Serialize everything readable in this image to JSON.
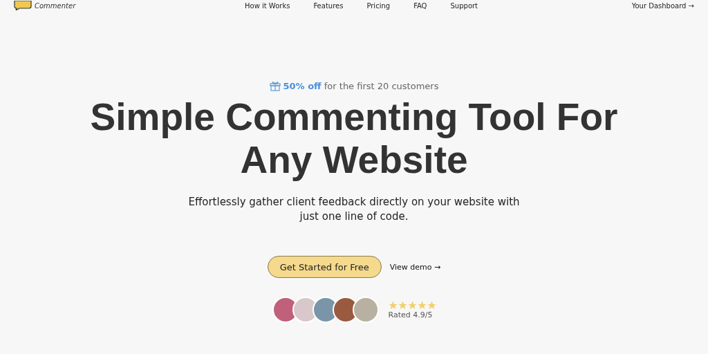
{
  "nav": {
    "logo_text": "Commenter",
    "links": [
      {
        "label": "How it Works"
      },
      {
        "label": "Features"
      },
      {
        "label": "Pricing"
      },
      {
        "label": "FAQ"
      },
      {
        "label": "Support"
      }
    ],
    "dashboard": "Your Dashboard →"
  },
  "hero": {
    "promo_highlight": "50% off",
    "promo_text": "for the first 20 customers",
    "title": "Simple Commenting Tool For Any Website",
    "subtitle": "Effortlessly gather client feedback directly on your website with just one line of code.",
    "primary_button": "Get Started for Free",
    "demo_link": "View demo →"
  },
  "social_proof": {
    "avatars": [
      {
        "color": "#c0607a"
      },
      {
        "color": "#d8c8cc"
      },
      {
        "color": "#7a95a8"
      },
      {
        "color": "#9a5a40"
      },
      {
        "color": "#b8b0a0"
      }
    ],
    "stars": 5,
    "rating": "Rated 4.9/5"
  }
}
